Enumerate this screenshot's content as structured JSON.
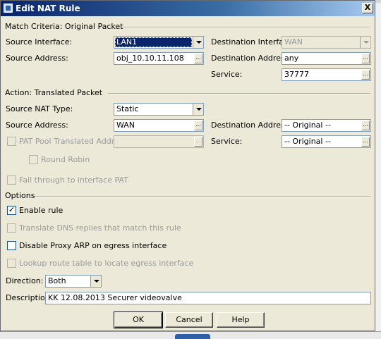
{
  "dialog": {
    "title": "Edit NAT Rule",
    "close_glyph": "X"
  },
  "match": {
    "section_title": "Match Criteria: Original Packet",
    "source_interface_label": "Source Interface:",
    "source_interface_value": "LAN1",
    "source_address_label": "Source Address:",
    "source_address_value": "obj_10.10.11.108",
    "destination_interface_label": "Destination Interface:",
    "destination_interface_value": "WAN",
    "destination_address_label": "Destination Address:",
    "destination_address_value": "any",
    "service_label": "Service:",
    "service_value": "37777"
  },
  "action": {
    "section_title": "Action: Translated Packet",
    "source_nat_type_label": "Source NAT Type:",
    "source_nat_type_value": "Static",
    "source_address_label": "Source Address:",
    "source_address_value": "WAN",
    "destination_address_label": "Destination Address:",
    "destination_address_value": "-- Original --",
    "pat_pool_label": "PAT Pool Translated Address:",
    "pat_pool_value": "",
    "service_label": "Service:",
    "service_value": "-- Original --",
    "round_robin_label": "Round Robin",
    "fall_through_label": "Fall through to interface PAT"
  },
  "options": {
    "section_title": "Options",
    "enable_rule_label": "Enable rule",
    "enable_rule_checked": true,
    "translate_dns_label": "Translate DNS replies that match this rule",
    "disable_proxy_arp_label": "Disable Proxy ARP on egress interface",
    "lookup_route_label": "Lookup route table to locate egress interface",
    "direction_label": "Direction:",
    "direction_value": "Both",
    "description_label": "Description:",
    "description_value": "KK 12.08.2013 Securer videovalve"
  },
  "buttons": {
    "ok": "OK",
    "cancel": "Cancel",
    "help": "Help"
  },
  "colors": {
    "dialog_bg": "#ece9d8",
    "titlebar_start": "#0a246a",
    "selection": "#0a246a"
  }
}
